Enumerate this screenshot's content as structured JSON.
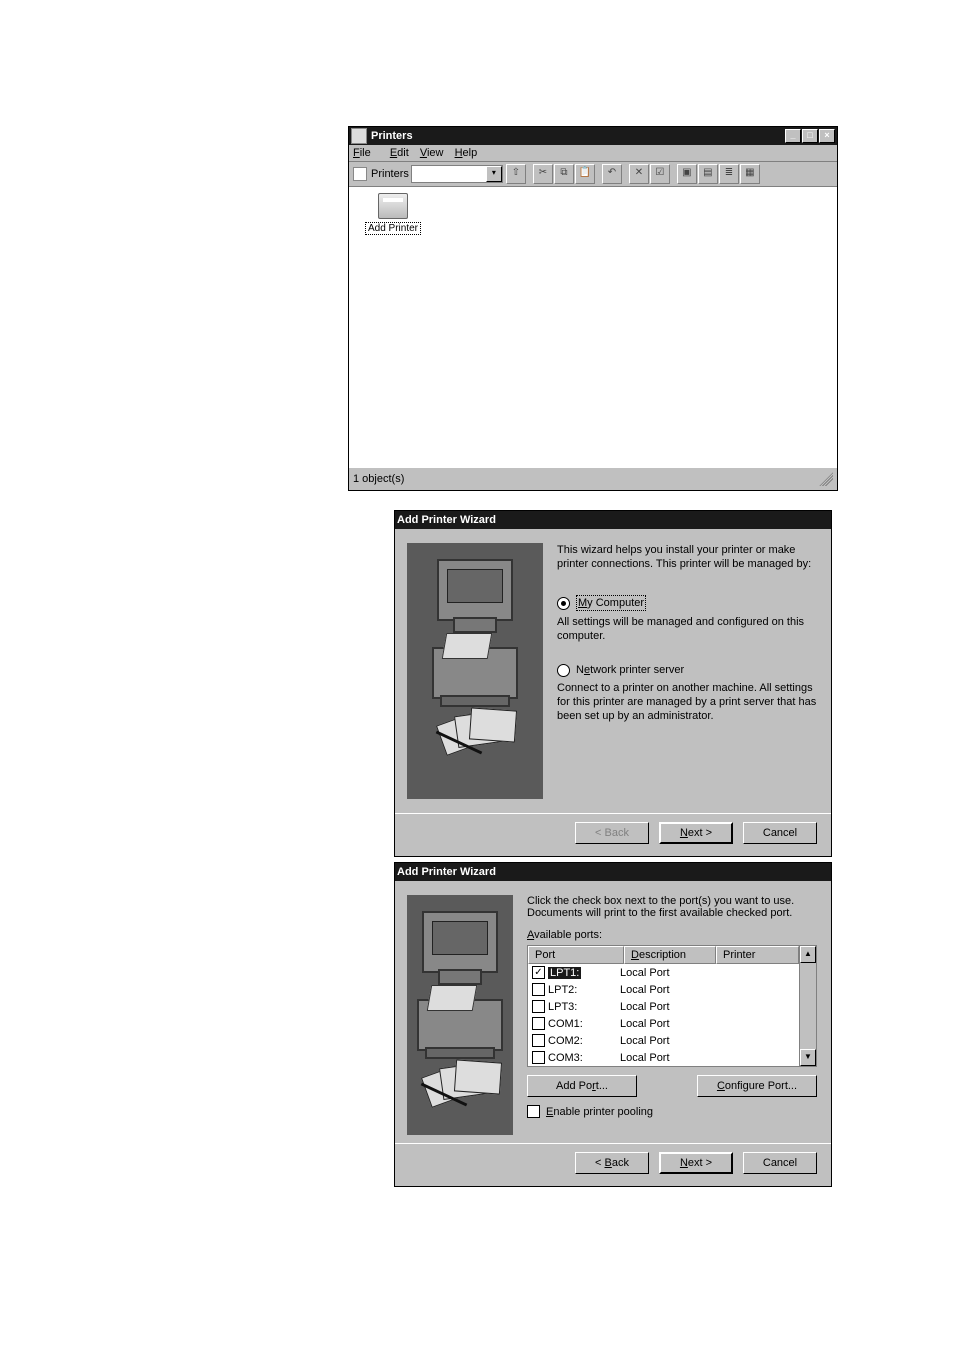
{
  "printersWindow": {
    "title": "Printers",
    "menu": {
      "file": "File",
      "edit": "Edit",
      "view": "View",
      "help": "Help"
    },
    "address_label": "Printers",
    "icon_label": "Add Printer",
    "status": "1 object(s)"
  },
  "wizard1": {
    "title": "Add Printer Wizard",
    "intro": "This wizard helps you install your printer or make printer connections.  This printer will be managed by:",
    "option_my_computer": "My Computer",
    "option_my_computer_desc": "All settings will be managed and configured on this computer.",
    "option_network": "Network printer server",
    "option_network_desc": "Connect to a printer on another machine.  All settings for this printer are managed by a print server that has been set up by an administrator.",
    "back": "< Back",
    "next": "Next >",
    "cancel": "Cancel"
  },
  "wizard2": {
    "title": "Add Printer Wizard",
    "intro": "Click the check box next to the port(s) you want to use. Documents will print to the first available checked port.",
    "available_label": "Available ports:",
    "headers": {
      "port": "Port",
      "desc": "Description",
      "printer": "Printer"
    },
    "ports": [
      {
        "name": "LPT1:",
        "desc": "Local Port",
        "printer": "",
        "checked": true,
        "selected": true
      },
      {
        "name": "LPT2:",
        "desc": "Local Port",
        "printer": "",
        "checked": false,
        "selected": false
      },
      {
        "name": "LPT3:",
        "desc": "Local Port",
        "printer": "",
        "checked": false,
        "selected": false
      },
      {
        "name": "COM1:",
        "desc": "Local Port",
        "printer": "",
        "checked": false,
        "selected": false
      },
      {
        "name": "COM2:",
        "desc": "Local Port",
        "printer": "",
        "checked": false,
        "selected": false
      },
      {
        "name": "COM3:",
        "desc": "Local Port",
        "printer": "",
        "checked": false,
        "selected": false
      }
    ],
    "add_port": "Add Port...",
    "configure_port": "Configure Port...",
    "pooling": "Enable printer pooling",
    "back": "< Back",
    "next": "Next >",
    "cancel": "Cancel"
  }
}
